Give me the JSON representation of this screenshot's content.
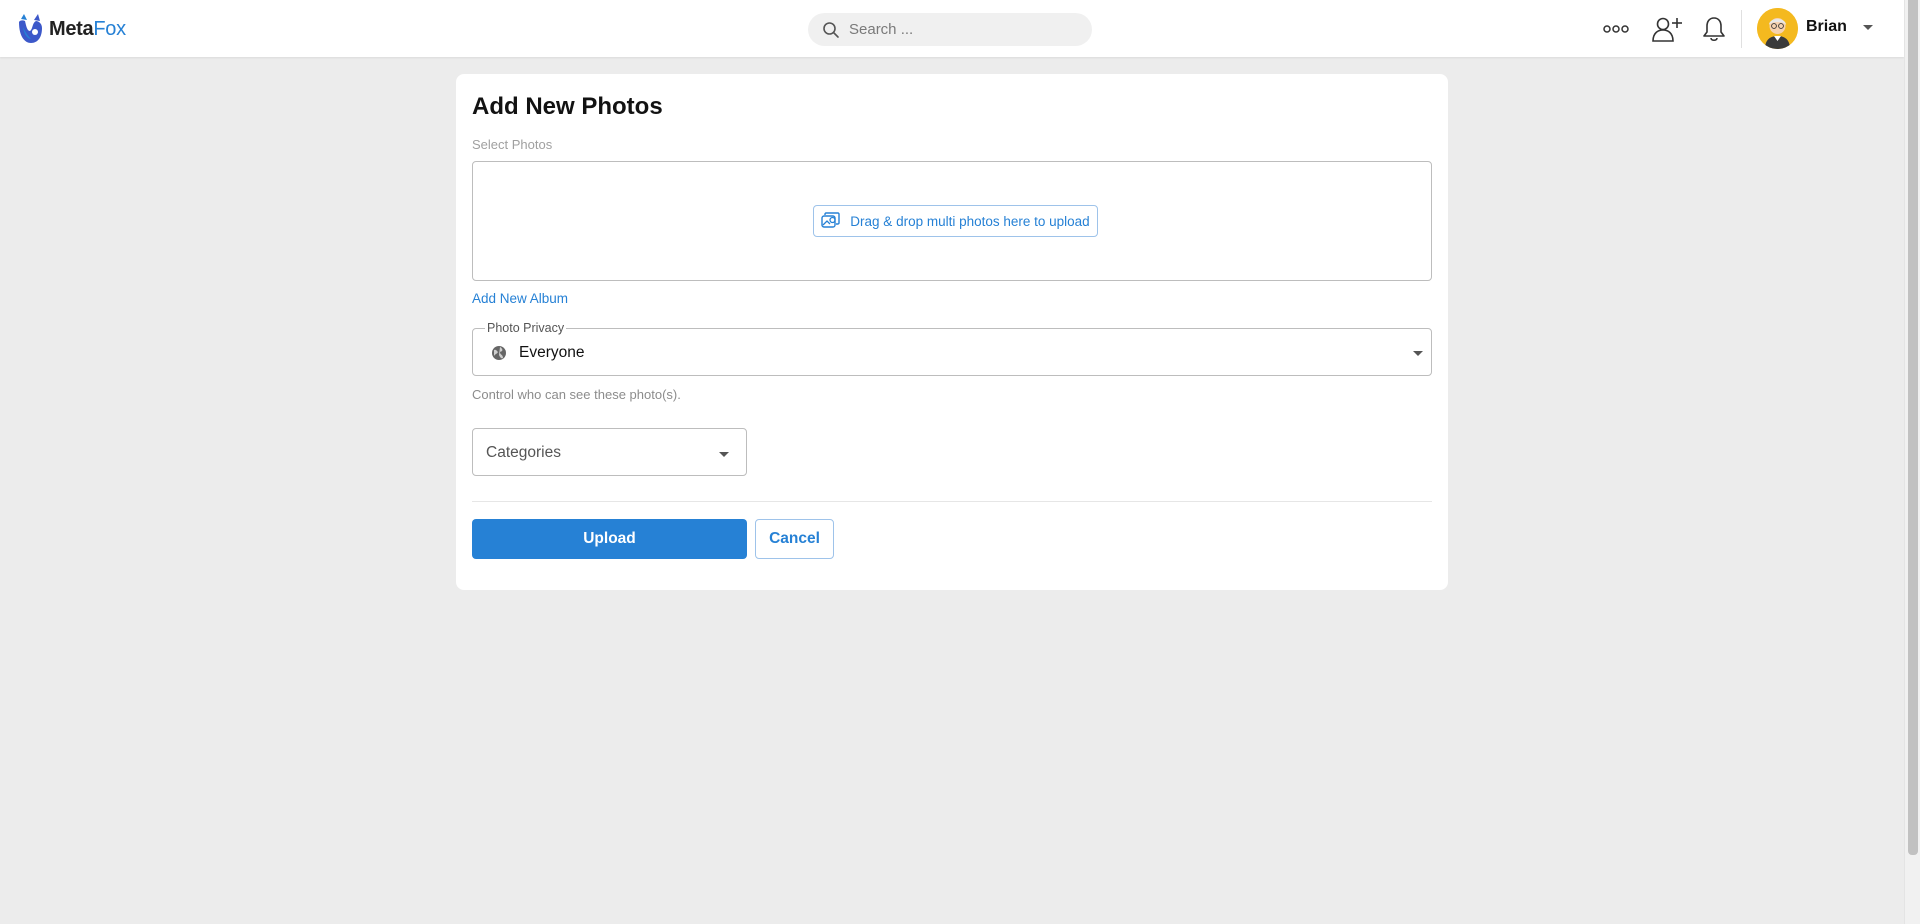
{
  "brand": {
    "name_part1": "Meta",
    "name_part2": "Fox",
    "logo_icon": "metafox-logo-icon"
  },
  "header": {
    "search_placeholder": "Search ...",
    "icons": [
      "more-icon",
      "add-friend-icon",
      "notification-bell-icon"
    ],
    "user": {
      "name": "Brian",
      "avatar_icon": "user-avatar"
    }
  },
  "form": {
    "title": "Add New Photos",
    "select_photos_label": "Select Photos",
    "dropzone_button": "Drag & drop multi photos here to upload",
    "add_album_link": "Add New Album",
    "privacy": {
      "legend": "Photo Privacy",
      "value": "Everyone",
      "icon": "globe-icon",
      "help": "Control who can see these photo(s)."
    },
    "categories_placeholder": "Categories",
    "upload_label": "Upload",
    "cancel_label": "Cancel"
  },
  "colors": {
    "accent": "#2681d5",
    "page_bg": "#ececec",
    "card_bg": "#ffffff",
    "logo_mark": "#3c58c9"
  }
}
